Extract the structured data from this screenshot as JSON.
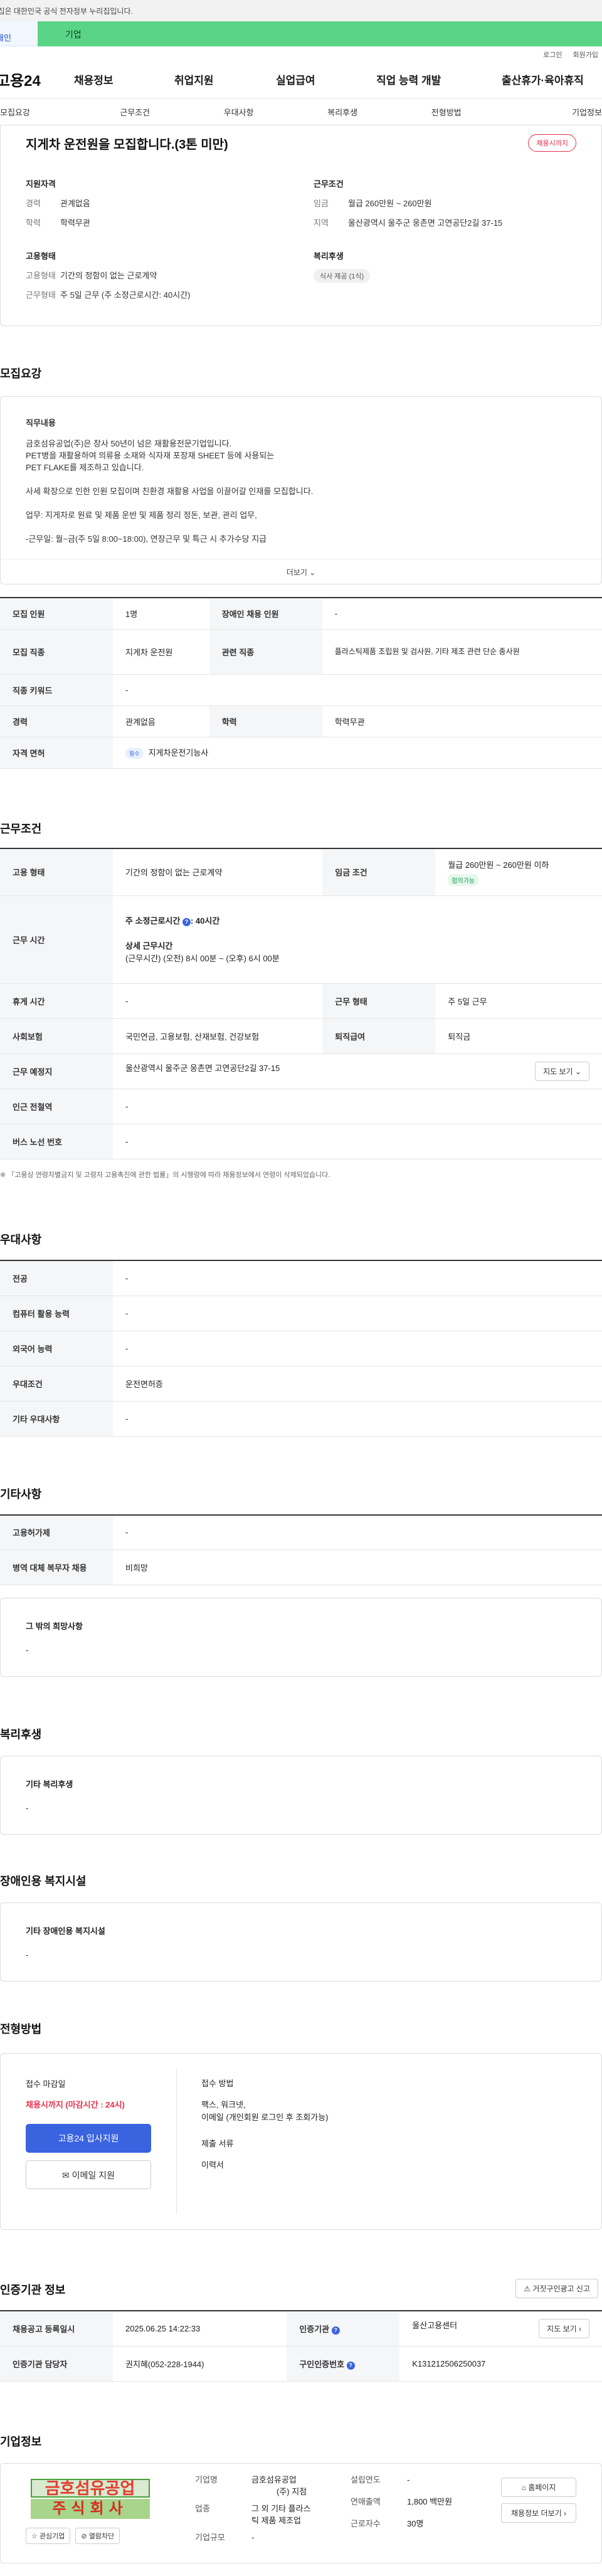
{
  "banner": {
    "text": "이 누리집은 대한민국 공식 전자정부 누리집입니다."
  },
  "tabs": {
    "personal": "개인",
    "company": "기업"
  },
  "util": {
    "login": "로그인",
    "join": "회원가입"
  },
  "logo": "고용24",
  "gnb": [
    "채용정보",
    "취업지원",
    "실업급여",
    "직업 능력 개발",
    "출산휴가·육아휴직"
  ],
  "subnav": [
    "모집요강",
    "근무조건",
    "우대사항",
    "복리후생",
    "전형방법",
    "기업정보"
  ],
  "head": {
    "title": "지게차 운전원을 모집합니다.(3톤 미만)",
    "badge": "채용시까지",
    "qual_title": "지원자격",
    "career_k": "경력",
    "career_v": "관계없음",
    "edu_k": "학력",
    "edu_v": "학력무관",
    "emp_title": "고용형태",
    "emptype_k": "고용형태",
    "emptype_v": "기간의 정함이 없는 근로계약",
    "worktype_k": "근무형태",
    "worktype_v": "주 5일 근무 (주 소정근로시간: 40시간)",
    "cond_title": "근무조건",
    "wage_k": "임금",
    "wage_v": "월급 260만원 ~ 260만원",
    "area_k": "지역",
    "area_v": "울산광역시 울주군 웅촌면 고연공단2길 37-15",
    "welfare_title": "복리후생",
    "welfare_chip": "식사 제공 (1식)"
  },
  "recruit": {
    "title": "모집요강",
    "duty_title": "직무내용",
    "desc": [
      "금호섬유공업(주)은 창사 50년이 넘은 재활용전문기업입니다.",
      "PET병을 재활용하여 의류용 소재와 식자재 포장재 SHEET 등에 사용되는",
      "PET FLAKE를 제조하고 있습니다.",
      "",
      "사세 확장으로 인한 인원 모집이며 친환경 재활용 사업을 이끌어갈 인재를 모집합니다.",
      "",
      "업무: 지게차로 원료 및 제품 운반 및  제품 정리 정돈, 보관, 관리 업무,",
      "",
      "-근무일: 월~금(주 5일 8:00~18:00), 연장근무 및 특근 시 추가수당 지급"
    ],
    "more": "더보기",
    "rows": [
      {
        "k1": "모집 인원",
        "v1": "1명",
        "k2": "장애인 채용 인원",
        "v2": "-"
      },
      {
        "k1": "모집 직종",
        "v1": "지게차 운전원",
        "k2": "관련 직종",
        "v2": "플라스틱제품 조립원 및 검사원, 기타 제조 관련 단순 종사원"
      },
      {
        "k1": "직종 키워드",
        "v1": "-",
        "k2": "",
        "v2": ""
      },
      {
        "k1": "경력",
        "v1": "관계없음",
        "k2": "학력",
        "v2": "학력무관"
      },
      {
        "k1": "자격 면허",
        "v1": "지게차운전기능사",
        "k2": "",
        "v2": ""
      }
    ],
    "license_chip": "필수"
  },
  "work": {
    "title": "근무조건",
    "emptype_k": "고용 형태",
    "emptype_v": "기간의 정함이 없는 근로계약",
    "wage_k": "임금 조건",
    "wage_v": "월급 260만원 ~ 260만원 이하",
    "wage_chip": "협의가능",
    "hours_k": "근무 시간",
    "hours_total": "주 소정근로시간",
    "hours_total_v": ": 40시간",
    "hours_detail_t": "상세 근무시간",
    "hours_detail_v": "(근무시간) (오전) 8시 00분 ~ (오후) 6시 00분",
    "rest_k": "휴게 시간",
    "rest_v": "-",
    "form_k": "근무 형태",
    "form_v": "주 5일 근무",
    "ins_k": "사회보험",
    "ins_v": "국민연금, 고용보험, 산재보험, 건강보험",
    "retire_k": "퇴직급여",
    "retire_v": "퇴직금",
    "place_k": "근무 예정지",
    "place_v": "울산광역시 울주군 웅촌면 고연공단2길 37-15",
    "map_btn": "지도 보기",
    "station_k": "인근 전철역",
    "station_v": "-",
    "bus_k": "버스 노선 번호",
    "bus_v": "-",
    "note": "※ 「고용상 연령차별금지 및 고령자 고용촉진에 관한 법률」의 시행령에 따라 채용정보에서 연령이 삭제되었습니다."
  },
  "pref": {
    "title": "우대사항",
    "rows": [
      {
        "k": "전공",
        "v": "-"
      },
      {
        "k": "컴퓨터 활용 능력",
        "v": "-"
      },
      {
        "k": "외국어 능력",
        "v": "-"
      },
      {
        "k": "우대조건",
        "v": "운전면허증"
      },
      {
        "k": "기타 우대사항",
        "v": "-"
      }
    ]
  },
  "etc": {
    "title": "기타사항",
    "rows": [
      {
        "k": "고용허가제",
        "v": "-"
      },
      {
        "k": "병역 대체 복무자 채용",
        "v": "비희망"
      }
    ],
    "other_title": "그 밖의 희망사항",
    "other_v": "-"
  },
  "welfare": {
    "title": "복리후생",
    "sub": "기타 복리후생",
    "v": "-"
  },
  "disab": {
    "title": "장애인용 복지시설",
    "sub": "기타 장애인용 복지시설",
    "v": "-"
  },
  "apply": {
    "title": "전형방법",
    "deadline_t": "접수 마감일",
    "deadline_v": "채용시까지 (마감시간 : 24시)",
    "btn_online": "고용24 입사지원",
    "btn_email": "이메일 지원",
    "method_t": "접수 방법",
    "method_v1": "팩스, 워크넷,",
    "method_v2": "이메일 (개인회원 로그인 후 조회가능)",
    "docs_t": "제출 서류",
    "docs_v": "이력서"
  },
  "cert": {
    "title": "인증기관 정보",
    "report_btn": "거짓구인광고 신고",
    "rows": [
      {
        "k1": "채용공고 등록일시",
        "v1": "2025.06.25 14:22:33",
        "k2": "인증기관",
        "v2": "울산고용센터"
      },
      {
        "k1": "인증기관 담당자",
        "v1": "권지혜(052-228-1944)",
        "k2": "구인인증번호",
        "v2": "K131212506250037"
      }
    ],
    "map_btn": "지도 보기"
  },
  "company": {
    "title": "기업정보",
    "logo_l1": "금호섬유공업",
    "logo_l2": "주식회사",
    "fav_btn": "관심기업",
    "block_btn": "열람차단",
    "name_k": "기업명",
    "name_v1": "금호섬유공업",
    "name_v2": "(주) 지점",
    "est_k": "설립연도",
    "est_v": "-",
    "type_k": "업종",
    "type_v1": "그 외 기타 플라스",
    "type_v2": "틱 제품 제조업",
    "sales_k": "연매출액",
    "sales_v": "1,800 백만원",
    "emp_k": "근로자수",
    "emp_v": "30명",
    "scale_k": "기업규모",
    "scale_v": "-",
    "home_btn": "홈페이지",
    "jobs_btn": "채용정보 더보기"
  }
}
